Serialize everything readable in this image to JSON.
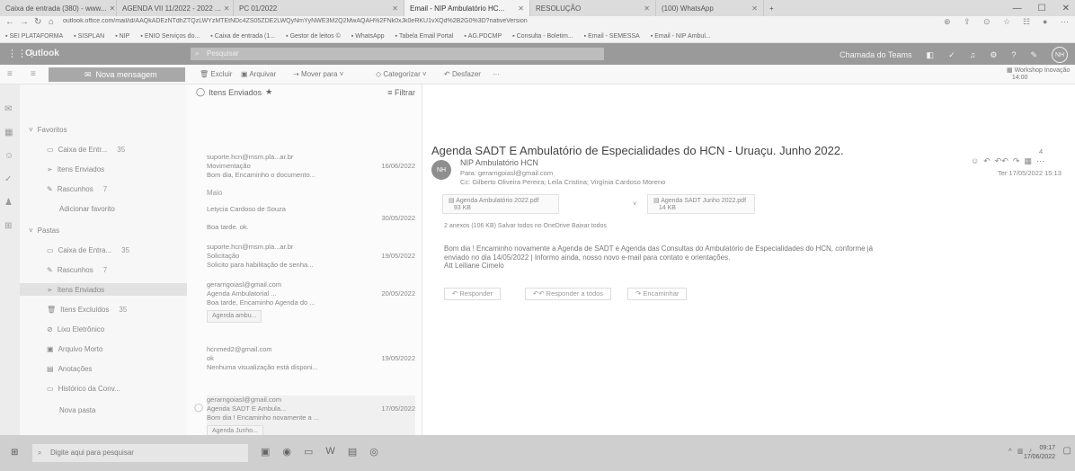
{
  "browser": {
    "tabs": [
      {
        "label": "Caixa de entrada (380) - www..."
      },
      {
        "label": "AGENDA VII 11/2022 - 2022 ..."
      },
      {
        "label": "PC 01/2022"
      },
      {
        "label": "Email - NIP Ambulatório HC..."
      },
      {
        "label": "RESOLUÇÃO"
      },
      {
        "label": "(100) WhatsApp"
      }
    ],
    "new_tab": "+",
    "url": "outlook.office.com/mail/id/AAQkADEzNTdhZTQzLWYzMTEtNDc4ZS05ZDE2LWQyNmYyNWE3M2Q2MwAQAH%2FNk0xJk0eRKU1vXQd%2B2G0%3D?nativeVersion",
    "bookmarks": [
      "SEI PLATAFORMA",
      "SISPLAN",
      "NIP",
      "ENIO Serviços do...",
      "Caixa de entrada (1...",
      "Gestor de leitos ©",
      "WhatsApp",
      "Tabela Email Portal",
      "AG.PDCMP",
      "Consulta - Boletim...",
      "Email - SEMESSA",
      "Email - NIP Ambul..."
    ]
  },
  "outlook": {
    "brand": "Outlook",
    "search_placeholder": "Pesquisar",
    "header_call": "Chamada do Teams",
    "avatar": "NH"
  },
  "command": {
    "new_message": "Nova mensagem",
    "delete": "Excluir",
    "archive": "Arquivar",
    "move": "Mover para",
    "categorize": "Categorizar",
    "undo": "Desfazer",
    "more": "···",
    "workshop": "Workshop Inovação",
    "workshop_time": "14:00"
  },
  "folders": {
    "favorites": "Favoritos",
    "fav_items": [
      {
        "label": "Caixa de Entr...",
        "count": "35"
      },
      {
        "label": "Itens Enviados",
        "count": ""
      },
      {
        "label": "Rascunhos",
        "count": "7"
      },
      {
        "label": "Adicionar favorito",
        "count": ""
      }
    ],
    "pastas": "Pastas",
    "pasta_items": [
      {
        "label": "Caixa de Entra...",
        "count": "35"
      },
      {
        "label": "Rascunhos",
        "count": "7"
      },
      {
        "label": "Itens Enviados",
        "count": ""
      },
      {
        "label": "Itens Excluídos",
        "count": "35"
      },
      {
        "label": "Lixo Eletrônico",
        "count": ""
      },
      {
        "label": "Arquivo Morto",
        "count": ""
      },
      {
        "label": "Anotações",
        "count": ""
      },
      {
        "label": "Histórico da Conv...",
        "count": ""
      },
      {
        "label": "Nova pasta",
        "count": ""
      }
    ]
  },
  "list": {
    "title": "Itens Enviados",
    "star": "★",
    "filter": "Filtrar",
    "group_maio": "Maio",
    "messages": [
      {
        "from": "suporte.hcn@msm.pla...ar.br",
        "date": "",
        "subject": "Movimentação",
        "date2": "16/06/2022",
        "snippet": "Bom dia, Encaminho o documento..."
      },
      {
        "from": "Letycia Cardoso de Souza",
        "date": "30/05/2022",
        "subject": "",
        "date2": "",
        "snippet": "Boa tarde. ok."
      },
      {
        "from": "suporte.hcn@msm.pla...ar.br",
        "date": "",
        "subject": "Solicitação",
        "date2": "19/05/2022",
        "snippet": "Solicito para habilitação de senha..."
      },
      {
        "from": "gerarngoiasl@gmail.com",
        "date": "",
        "subject": "Agenda Ambulatorial ...",
        "date2": "20/05/2022",
        "snippet": "Boa tarde, Encaminho Agenda do ...",
        "attachment": "Agenda ambu..."
      },
      {
        "from": "hcnmed2@gmail.com",
        "date": "",
        "subject": "ok",
        "date2": "19/05/2022",
        "snippet": "Nenhuma visualização está disponi..."
      },
      {
        "from": "gerarngoiasl@gmail.com",
        "date": "",
        "subject": "Agenda SADT E Ambula...",
        "date2": "17/05/2022",
        "snippet": "Bom dia ! Encaminho novamente a ...",
        "attachment": "Agenda Junho..."
      }
    ]
  },
  "reading": {
    "subject": "Agenda SADT E Ambulatório de Especialidades do HCN - Uruaçu. Junho 2022.",
    "sender_initials": "NH",
    "sender": "NIP Ambulatório HCN",
    "to": "Para: gerarngoiasl@gmail.com",
    "cc": "Cc: Gilberto Oliveira Pereira; Leila Cristina; Virgínia Cardoso Moreno",
    "date": "Ter 17/05/2022 15:13",
    "attachments": [
      {
        "name": "Agenda Ambulatório 2022.pdf",
        "size": "93 KB"
      },
      {
        "name": "Agenda SADT Junho 2022.pdf",
        "size": "14 KB"
      }
    ],
    "attach_summary": "2 anexos (106 KB)   Salvar todos no OneDrive   Baixar todos",
    "body_line1": "Bom dia ! Encaminho novamente a Agenda de SADT e Agenda das Consultas do Ambulatório de Especialidades do HCN, conforme já",
    "body_line2": "enviado no dia 14/05/2022 | Informo ainda, nosso novo e-mail para contato e orientações.",
    "body_line3": "Att Leiliane Cimelo",
    "reply": "Responder",
    "reply_all": "Responder a todos",
    "forward": "Encaminhar",
    "count_badge": "4"
  },
  "taskbar": {
    "search": "Digite aqui para pesquisar",
    "time": "09:17",
    "date": "17/06/2022"
  }
}
